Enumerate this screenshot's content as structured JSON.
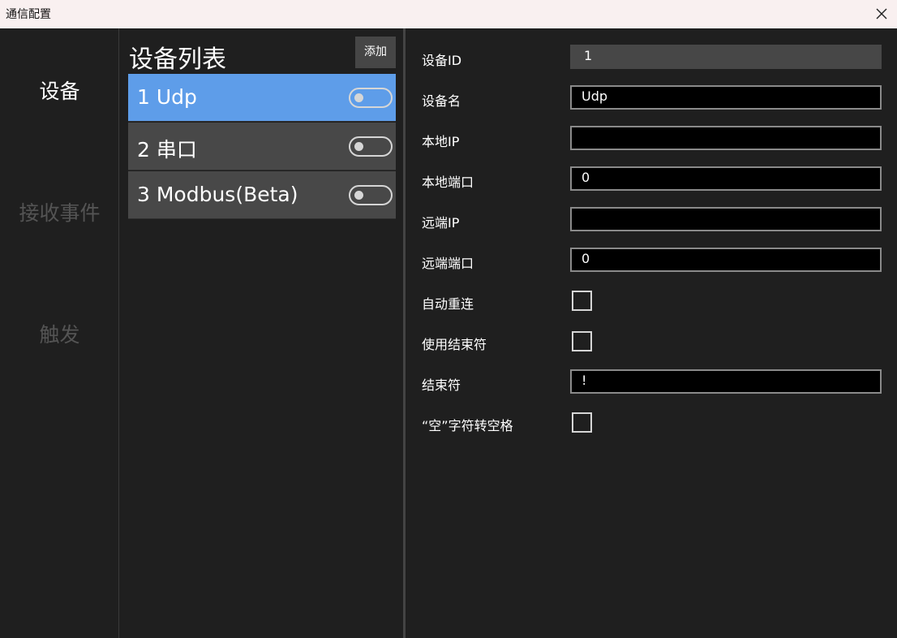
{
  "window": {
    "title": "通信配置",
    "close_icon": "close-icon"
  },
  "nav": {
    "items": [
      {
        "label": "设备",
        "active": true
      },
      {
        "label": "接收事件",
        "active": false
      },
      {
        "label": "触发",
        "active": false
      }
    ]
  },
  "device_list": {
    "title": "设备列表",
    "add_label": "添加",
    "items": [
      {
        "label": "1 Udp",
        "selected": true,
        "enabled": false
      },
      {
        "label": "2 串口",
        "selected": false,
        "enabled": false
      },
      {
        "label": "3 Modbus(Beta)",
        "selected": false,
        "enabled": false
      }
    ]
  },
  "form": {
    "device_id": {
      "label": "设备ID",
      "value": "1"
    },
    "device_name": {
      "label": "设备名",
      "value": "Udp"
    },
    "local_ip": {
      "label": "本地IP",
      "value": ""
    },
    "local_port": {
      "label": "本地端口",
      "value": "0"
    },
    "remote_ip": {
      "label": "远端IP",
      "value": ""
    },
    "remote_port": {
      "label": "远端端口",
      "value": "0"
    },
    "auto_reconnect": {
      "label": "自动重连",
      "checked": false
    },
    "use_terminator": {
      "label": "使用结束符",
      "checked": false
    },
    "terminator": {
      "label": "结束符",
      "value": "!"
    },
    "null_to_space": {
      "label": "“空”字符转空格",
      "checked": false
    }
  },
  "colors": {
    "accent": "#5e9de9",
    "background": "#1f1f1f",
    "titlebar": "#f9f0f0",
    "list_item": "#484848",
    "inactive_text": "#545454"
  }
}
